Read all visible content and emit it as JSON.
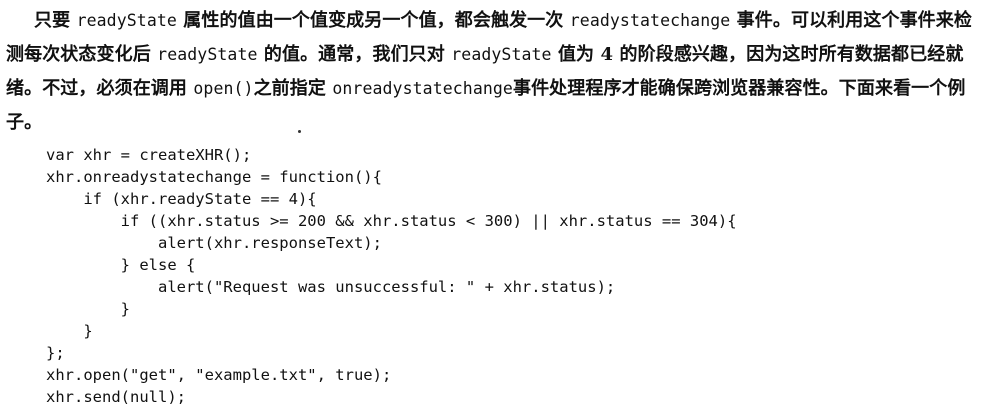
{
  "paragraph": {
    "t1": "只要 ",
    "c1": "readyState",
    "t2": " 属性的值由一个值变成另一个值，都会触发一次 ",
    "c2": "readystatechange",
    "t3": " 事件。可以利用这个事件来检测每次状态变化后 ",
    "c3": "readyState",
    "t4": " 的值。通常，我们只对 ",
    "c4": "readyState",
    "t5": " 值为 4 的阶段感兴趣，因为这时所有数据都已经就绪。不过，必须在调用 ",
    "c5": "open()",
    "t6": "之前指定 ",
    "c6": "onreadystatechange",
    "t7": "事件处理程序才能确保跨浏览器兼容性。下面来看一个例子。"
  },
  "code": {
    "lines": [
      "var xhr = createXHR();",
      "xhr.onreadystatechange = function(){",
      "    if (xhr.readyState == 4){",
      "        if ((xhr.status >= 200 && xhr.status < 300) || xhr.status == 304){",
      "            alert(xhr.responseText);",
      "        } else {",
      "            alert(\"Request was unsuccessful: \" + xhr.status);",
      "        }",
      "    }",
      "};",
      "xhr.open(\"get\", \"example.txt\", true);",
      "xhr.send(null);"
    ]
  }
}
